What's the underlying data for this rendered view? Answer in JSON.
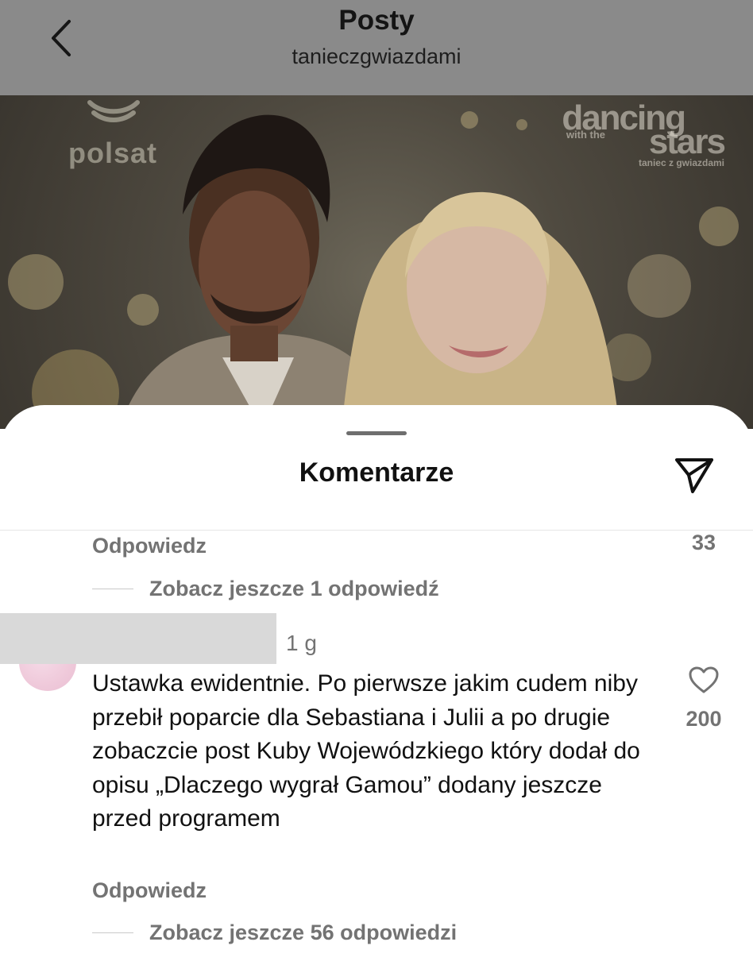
{
  "header": {
    "title": "Posty",
    "subtitle": "tanieczgwiazdami"
  },
  "post_image": {
    "logo_left": "polsat",
    "logo_right_line1": "dancing",
    "logo_right_line2": "with the",
    "logo_right_line3": "stars",
    "logo_right_line4": "taniec z gwiazdami"
  },
  "comments_sheet": {
    "title": "Komentarze",
    "prev_comment": {
      "reply_label": "Odpowiedz",
      "like_count": "33",
      "view_replies": "Zobacz jeszcze 1 odpowiedź"
    },
    "comment": {
      "timestamp": "1 g",
      "text": "Ustawka ewidentnie. Po pierwsze jakim cudem niby przebił poparcie dla Sebastiana i Julii a po drugie zobaczcie post Kuby Wojewódzkiego który dodał do opisu „Dlaczego wygrał Gamou” dodany jeszcze przed programem",
      "like_count": "200",
      "reply_label": "Odpowiedz",
      "view_replies": "Zobacz jeszcze 56 odpowiedzi"
    }
  },
  "colors": {
    "header_bg": "#8a8a8a",
    "secondary_text": "#737373",
    "primary_text": "#111111"
  },
  "icons": [
    "back-chevron-icon",
    "share-send-icon",
    "heart-outline-icon"
  ]
}
